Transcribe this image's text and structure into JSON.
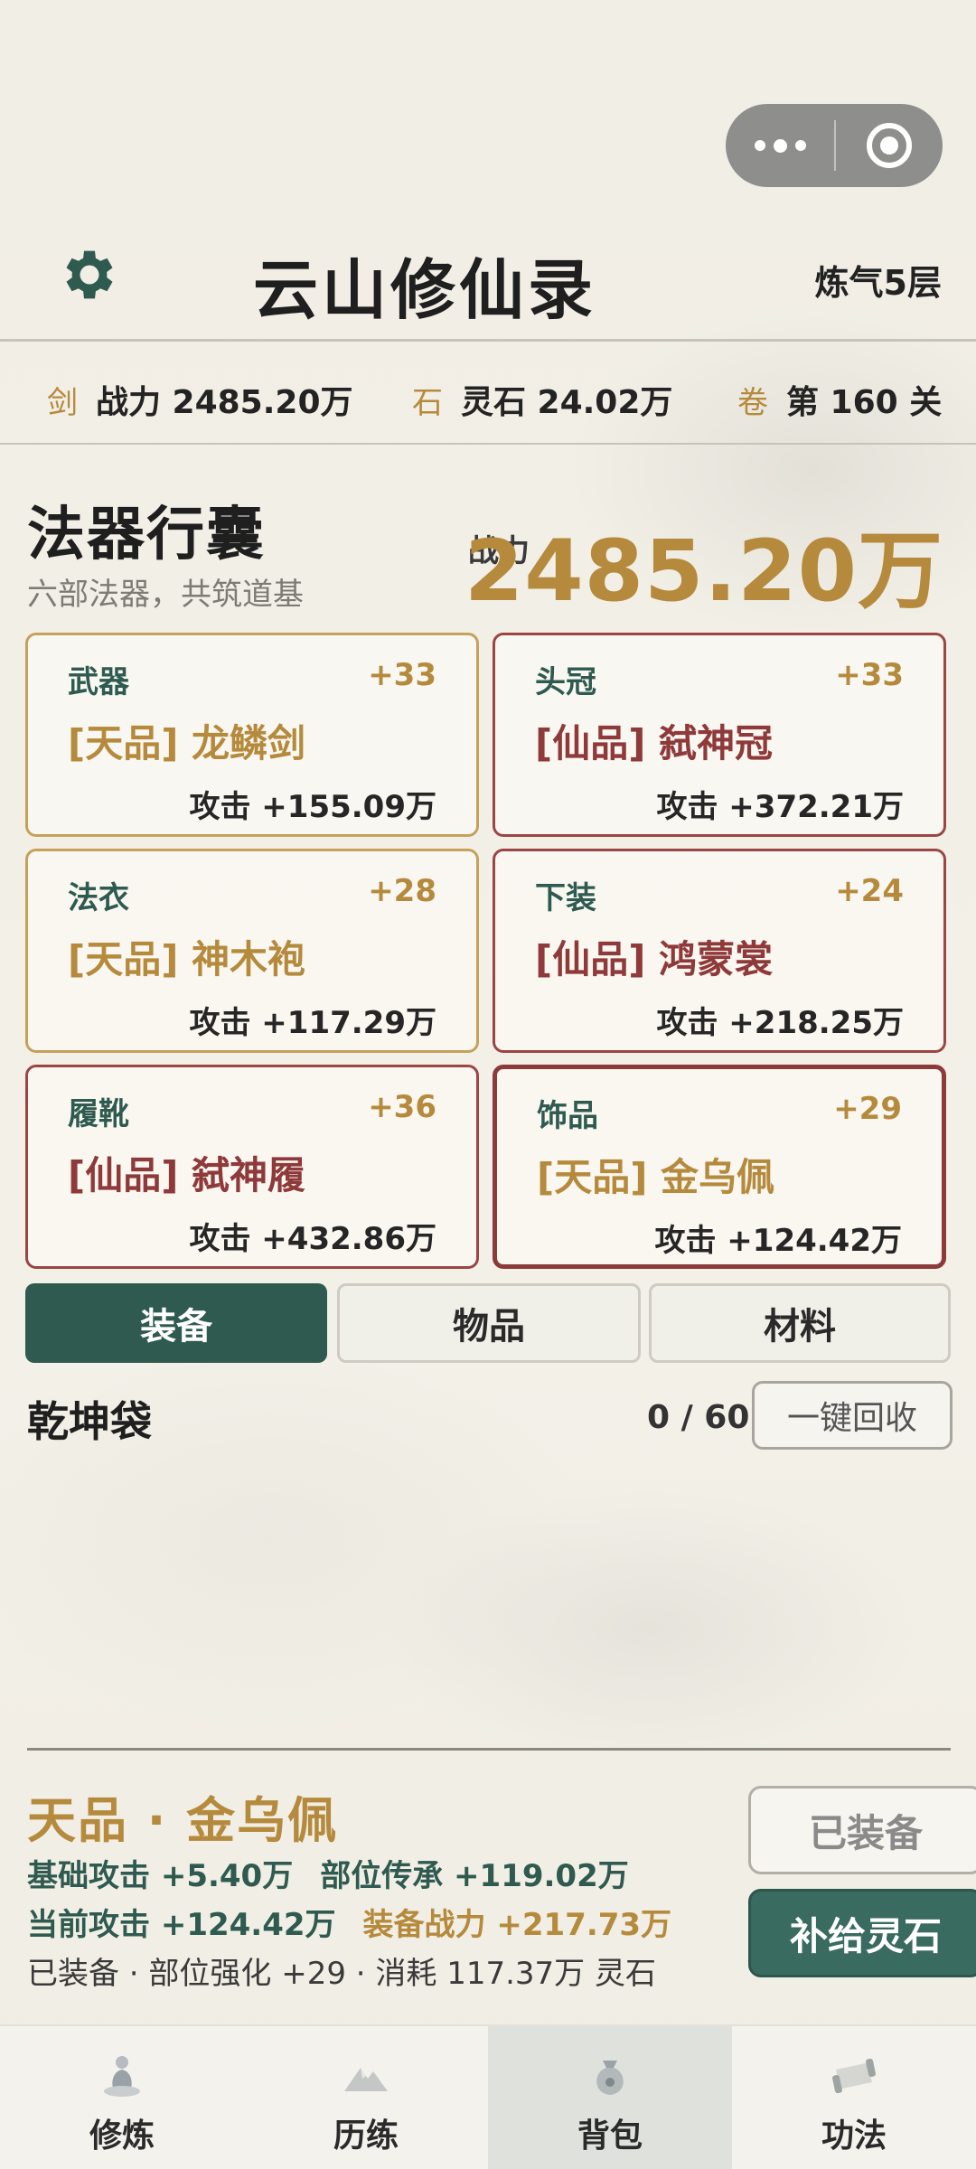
{
  "app": {
    "title": "云山修仙录",
    "realm": "炼气5层"
  },
  "stats": [
    {
      "tag": "剑",
      "value": "战力 2485.20万"
    },
    {
      "tag": "石",
      "value": "灵石 24.02万"
    },
    {
      "tag": "卷",
      "value": "第 160 关"
    }
  ],
  "bag_header": {
    "title": "法器行囊",
    "subtitle": "六部法器，共筑道基",
    "power_label": "战力",
    "power_value": "2485.20万"
  },
  "equipment": [
    {
      "slot": "武器",
      "level": "+33",
      "name": "[天品] 龙鳞剑",
      "attack": "攻击 +155.09万",
      "grade": "tian"
    },
    {
      "slot": "头冠",
      "level": "+33",
      "name": "[仙品] 弑神冠",
      "attack": "攻击 +372.21万",
      "grade": "xian"
    },
    {
      "slot": "法衣",
      "level": "+28",
      "name": "[天品] 神木袍",
      "attack": "攻击 +117.29万",
      "grade": "tian"
    },
    {
      "slot": "下装",
      "level": "+24",
      "name": "[仙品] 鸿蒙裳",
      "attack": "攻击 +218.25万",
      "grade": "xian"
    },
    {
      "slot": "履靴",
      "level": "+36",
      "name": "[仙品] 弑神履",
      "attack": "攻击 +432.86万",
      "grade": "xian"
    },
    {
      "slot": "饰品",
      "level": "+29",
      "name": "[天品] 金乌佩",
      "attack": "攻击 +124.42万",
      "grade": "tian",
      "selected": true
    }
  ],
  "tabs": [
    {
      "label": "装备",
      "active": true
    },
    {
      "label": "物品",
      "active": false
    },
    {
      "label": "材料",
      "active": false
    }
  ],
  "bag": {
    "title": "乾坤袋",
    "count": "0 / 60",
    "recycle_label": "一键回收"
  },
  "detail": {
    "title": "天品 · 金乌佩",
    "base_attack": "基础攻击 +5.40万",
    "inherit": "部位传承 +119.02万",
    "current_attack": "当前攻击 +124.42万",
    "equip_power": "装备战力 +217.73万",
    "status_line": "已装备 · 部位强化 +29 · 消耗 117.37万 灵石",
    "equipped_label": "已装备",
    "supply_label": "补给灵石"
  },
  "nav": [
    {
      "label": "修炼",
      "icon": "meditating-figure-icon"
    },
    {
      "label": "历练",
      "icon": "mountain-icon"
    },
    {
      "label": "背包",
      "icon": "pouch-icon",
      "active": true
    },
    {
      "label": "功法",
      "icon": "scroll-icon"
    }
  ],
  "colors": {
    "gold": "#b58a3c",
    "jade": "#2f5a50",
    "crimson": "#8f3a3a",
    "background": "#f3f0e6"
  }
}
